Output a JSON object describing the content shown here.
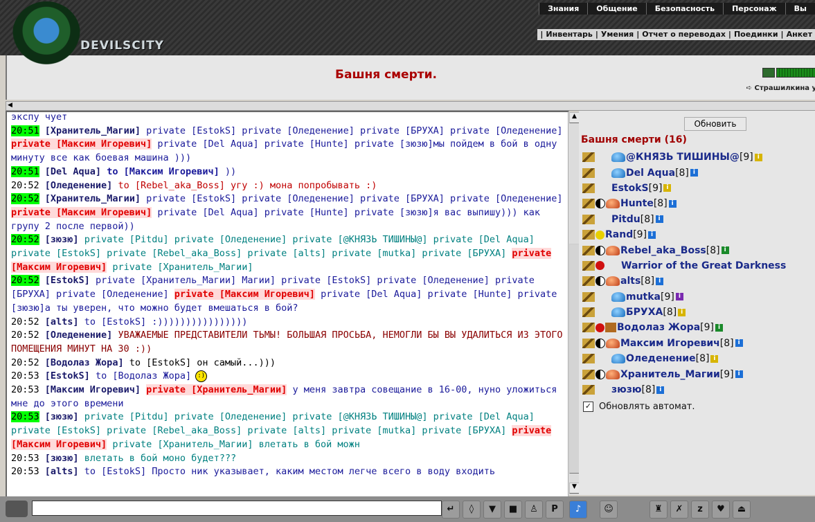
{
  "header": {
    "brand": "DEVILSCITY",
    "top_menu": [
      "Знания",
      "Общение",
      "Безопасность",
      "Персонаж",
      "Вы"
    ],
    "sub_menu": [
      "Инвентарь",
      "Умения",
      "Отчет о переводах",
      "Поединки",
      "Анкет"
    ],
    "room_title": "Башня смерти.",
    "player": "Страшилкина у"
  },
  "chat": {
    "lines": [
      {
        "html": "<span class='t-blue'>экспу чует</span>"
      },
      {
        "html": "<span class='time hl'>20:51</span> <span class='nick'>[Хранитель_Магии]</span> <span class='pv'>private [EstokS] private [Оледенение] private [БРУХА] private [Оледенение]</span> <span class='pv-red'>private [Максим Игоревич]</span> <span class='pv'>private [Del Aqua] private [Hunte] private [зюзю]мы пойдем в бой в одну минуту все как боевая машина )))</span>"
      },
      {
        "html": "<span class='time hl'>20:51</span> <span class='nick'>[Del Aqua]</span> <span class='t-blue'><b>to [Максим Игоревич]</b> ))</span>"
      },
      {
        "html": "<span class='time'>20:52</span> <span class='nick'>[Оледенение]</span> <span class='t-red'>to [Rebel_aka_Boss] угу :) мона попробывать :)</span>"
      },
      {
        "html": "<span class='time hl'>20:52</span> <span class='nick'>[Хранитель_Магии]</span> <span class='pv'>private [EstokS] private [Оледенение] private [БРУХА] private [Оледенение]</span> <span class='pv-red'>private [Максим Игоревич]</span> <span class='pv'>private [Del Aqua] private [Hunte] private [зюзю]я вас выпишу))) как групу 2 после первой))</span>"
      },
      {
        "html": "<span class='time hl'>20:52</span> <span class='nick'>[зюзю]</span> <span class='t-teal'>private [Pitdu] private [Оледенение] private [@КНЯЗЬ ТИШИНЫ@] private [Del Aqua] private [EstokS] private [Rebel_aka_Boss] private [alts] private [mutka] private [БРУХА]</span> <span class='pv-red'>private [Максим Игоревич]</span> <span class='t-teal'>private [Хранитель_Магии]</span>"
      },
      {
        "html": "<span class='time hl'>20:52</span> <span class='nick'>[EstokS]</span> <span class='pv'>private [Хранитель_Магии] Магии] private [EstokS] private [Оледенение] private [БРУХА] private [Оледенение]</span> <span class='pv-red'>private [Максим Игоревич]</span> <span class='pv'>private [Del Aqua] private [Hunte] private [зюзю]а ты уверен, что можно будет вмешаться в бой?</span>"
      },
      {
        "html": "<span class='time'>20:52</span> <span class='nick'>[alts]</span> <span class='t-blue'>to [EstokS] :))))))))))))))))</span>"
      },
      {
        "html": "<span class='time'>20:52</span> <span class='nick'>[Оледенение]</span> <span class='t-darkred'>УВАЖАЕМЫЕ ПРЕДСТАВИТЕЛИ ТЬМЫ! БОЛЬШАЯ ПРОСЬБА, НЕМОГЛИ БЫ ВЫ УДАЛИТЬСЯ ИЗ ЭТОГО ПОМЕЩЕНИЯ МИНУТ НА 30 :))</span>"
      },
      {
        "html": "<span class='time'>20:52</span> <span class='nick'>[Водолаз Жора]</span> to [EstokS] он самый...)))"
      },
      {
        "html": "<span class='time'>20:53</span> <span class='nick'>[EstokS]</span> <span class='t-blue'>to [Водолаз Жора]</span><span class='smiley'>:)</span>"
      },
      {
        "html": "<span class='time'>20:53</span> <span class='nick'>[Максим Игоревич]</span> <span class='pv-red'>private [Хранитель_Магии]</span> <span class='t-blue'>у меня завтра совещание в 16-00, нуно уложиться мне до этого времени</span>"
      },
      {
        "html": "<span class='time hl'>20:53</span> <span class='nick'>[зюзю]</span> <span class='t-teal'>private [Pitdu] private [Оледенение] private [@КНЯЗЬ ТИШИНЫ@] private [Del Aqua] private [EstokS] private [Rebel_aka_Boss] private [alts] private [mutka] private [БРУХА]</span> <span class='pv-red'>private [Максим Игоревич]</span> <span class='t-teal'>private [Хранитель_Магии] влетать в бой можн</span>"
      },
      {
        "html": "<span class='time'>20:53</span> <span class='nick'>[зюзю]</span> <span class='t-teal'>влетать в бой моно будет???</span>"
      },
      {
        "html": "<span class='time'>20:53</span> <span class='nick'>[alts]</span> <span class='t-blue'>to [EstokS] Просто ник указывает, каким местом легче всего в воду входить</span>"
      }
    ]
  },
  "side": {
    "refresh_label": "Обновить",
    "title": "Башня смерти (16)",
    "users": [
      {
        "name": "@КНЯЗЬ ТИШИНЫ@",
        "level": "[9]",
        "align": "blue-helm",
        "info": "y"
      },
      {
        "name": "Del Aqua",
        "level": "[8]",
        "align": "blue-helm",
        "info": "b"
      },
      {
        "name": "EstokS",
        "level": "[9]",
        "align": "none",
        "info": "y"
      },
      {
        "name": "Hunte",
        "level": "[8]",
        "align": "yin-red",
        "info": "b"
      },
      {
        "name": "Pitdu",
        "level": "[8]",
        "align": "none",
        "info": "b"
      },
      {
        "name": "Rand",
        "level": "[9]",
        "align": "yellow",
        "info": "b"
      },
      {
        "name": "Rebel_aka_Boss",
        "level": "[8]",
        "align": "yin-red",
        "info": "g"
      },
      {
        "name": "Warrior of the Great Darkness",
        "level": "",
        "align": "red",
        "info": ""
      },
      {
        "name": "alts",
        "level": "[8]",
        "align": "yin-red",
        "info": "b"
      },
      {
        "name": "mutka",
        "level": "[9]",
        "align": "blue-helm",
        "info": "p"
      },
      {
        "name": "БРУХА",
        "level": "[8]",
        "align": "blue-helm",
        "info": "y"
      },
      {
        "name": "Водолаз Жора",
        "level": "[9]",
        "align": "red-chest",
        "info": "g"
      },
      {
        "name": "Максим Игоревич",
        "level": "[8]",
        "align": "yin-red",
        "info": "b"
      },
      {
        "name": "Оледенение",
        "level": "[8]",
        "align": "blue-helm",
        "info": "y"
      },
      {
        "name": "Хранитель_Магии",
        "level": "[9]",
        "align": "yin-red",
        "info": "b"
      },
      {
        "name": "зюзю",
        "level": "[8]",
        "align": "none",
        "info": "b"
      }
    ],
    "auto_refresh_label": "Обновлять автомат.",
    "auto_refresh_checked": true
  },
  "bottom": {
    "input_value": "",
    "tools": [
      "enter",
      "eraser",
      "filter",
      "save",
      "walker",
      "translit",
      "music",
      "smile",
      "fist",
      "strike",
      "zz",
      "heart",
      "exit"
    ]
  }
}
